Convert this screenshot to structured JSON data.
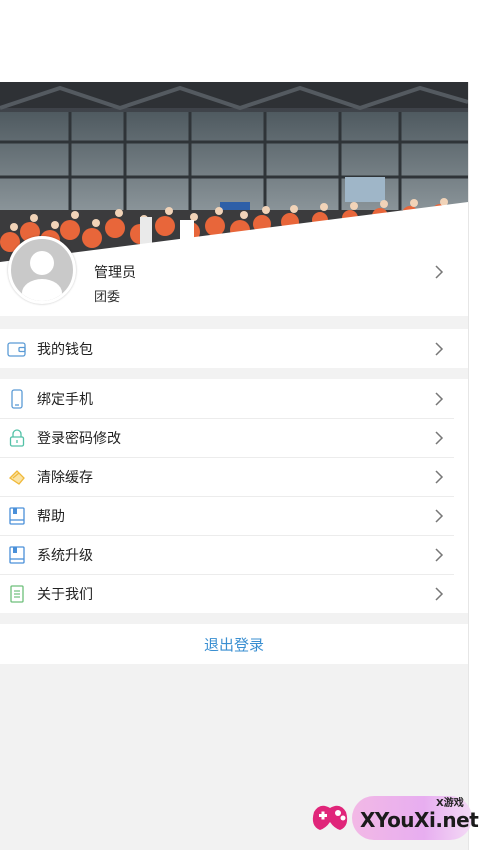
{
  "profile": {
    "name": "管理员",
    "org": "团委"
  },
  "wallet": {
    "label": "我的钱包",
    "icon": "wallet-icon"
  },
  "menu": [
    {
      "label": "绑定手机",
      "icon": "phone-icon",
      "color": "#5b9bd5"
    },
    {
      "label": "登录密码修改",
      "icon": "lock-icon",
      "color": "#53c1a7"
    },
    {
      "label": "清除缓存",
      "icon": "broom-icon",
      "color": "#f0b93a"
    },
    {
      "label": "帮助",
      "icon": "book-icon",
      "color": "#4a90d9"
    },
    {
      "label": "系统升级",
      "icon": "book-upgrade-icon",
      "color": "#4a90d9"
    },
    {
      "label": "关于我们",
      "icon": "document-icon",
      "color": "#6dbf7a"
    }
  ],
  "logout": {
    "label": "退出登录",
    "color": "#3a8fd1"
  },
  "watermark": {
    "brand": "XYouXi.net",
    "small": "X游戏"
  }
}
